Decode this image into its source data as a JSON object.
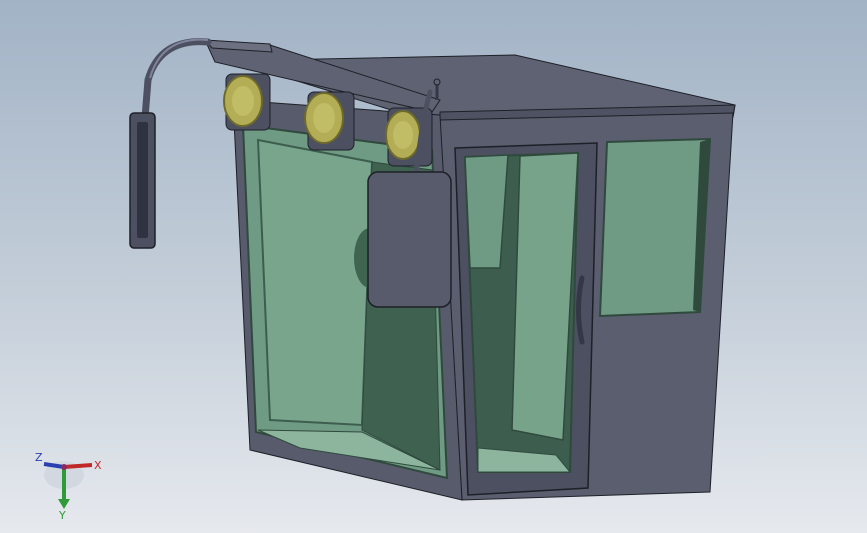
{
  "viewport": {
    "background_top": "#a2b3c6",
    "background_bottom": "#e6e9ee"
  },
  "model": {
    "name": "cab-model",
    "colors": {
      "body": "#5a5e6e",
      "body_dark": "#454856",
      "edge": "#1e2028",
      "glass": "#6f9a84",
      "glass_dark": "#3d5e4e",
      "glass_frame": "#2f4a3d",
      "lamp": "#b3ad56",
      "lamp_rim": "#6e6a2c"
    },
    "components": [
      "roof",
      "front-light-bar",
      "work-lamp-left",
      "work-lamp-center",
      "work-lamp-right",
      "side-mirror-left",
      "mirror-arm",
      "front-mirror",
      "front-windshield",
      "door",
      "door-handle",
      "rear-side-window",
      "antenna"
    ]
  },
  "triad": {
    "x_label": "X",
    "y_label": "Y",
    "z_label": "Z",
    "x_color": "#c0282a",
    "y_color": "#2e9a3a",
    "z_color": "#2a3fb0"
  }
}
